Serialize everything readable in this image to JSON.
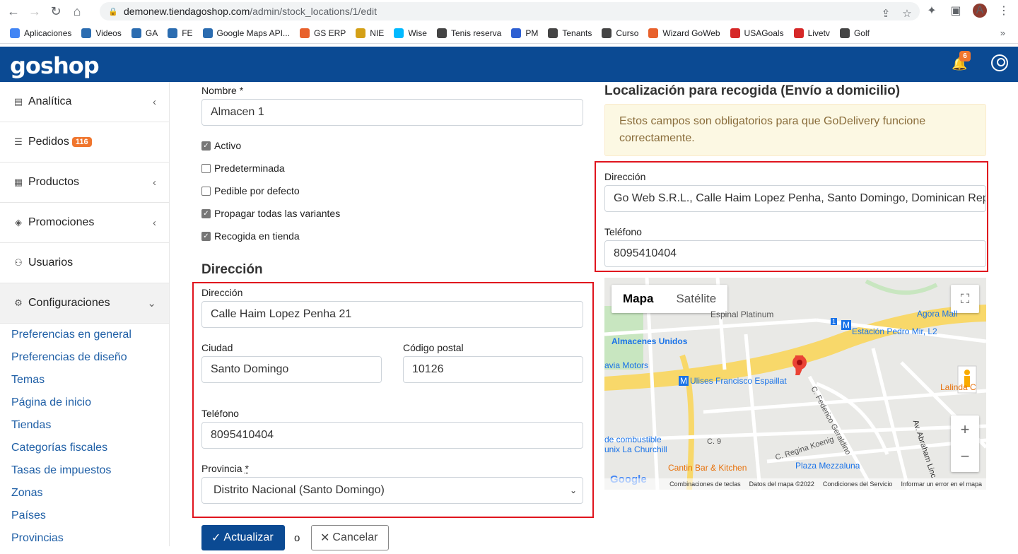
{
  "browser": {
    "url_host": "demonew.tiendagoshop.com",
    "url_path": "/admin/stock_locations/1/edit",
    "avatar_letter": "A",
    "bookmarks": [
      {
        "label": "Aplicaciones",
        "color": "#4285f4"
      },
      {
        "label": "Videos",
        "color": "#2b6cb0"
      },
      {
        "label": "GA",
        "color": "#2b6cb0"
      },
      {
        "label": "FE",
        "color": "#2b6cb0"
      },
      {
        "label": "Google Maps API...",
        "color": "#2b6cb0"
      },
      {
        "label": "GS ERP",
        "color": "#e8612c"
      },
      {
        "label": "NIE",
        "color": "#d4a017"
      },
      {
        "label": "Wise",
        "color": "#00b9ff"
      },
      {
        "label": "Tenis reserva",
        "color": "#444444"
      },
      {
        "label": "PM",
        "color": "#2d5fd2"
      },
      {
        "label": "Tenants",
        "color": "#444444"
      },
      {
        "label": "Curso",
        "color": "#444444"
      },
      {
        "label": "Wizard GoWeb",
        "color": "#e8612c"
      },
      {
        "label": "USAGoals",
        "color": "#d62828"
      },
      {
        "label": "Livetv",
        "color": "#d62828"
      },
      {
        "label": "Golf",
        "color": "#444444"
      }
    ],
    "more": "»"
  },
  "app": {
    "logo": "goshop",
    "notifications": "6"
  },
  "sidebar": {
    "items": [
      {
        "label": "Analítica",
        "icon": "📄"
      },
      {
        "label": "Pedidos",
        "icon": "☰",
        "badge": "116"
      },
      {
        "label": "Productos",
        "icon": "▦"
      },
      {
        "label": "Promociones",
        "icon": "🏷"
      },
      {
        "label": "Usuarios",
        "icon": "👥"
      },
      {
        "label": "Configuraciones",
        "icon": "⚙"
      }
    ],
    "sub_items": [
      "Preferencias en general",
      "Preferencias de diseño",
      "Temas",
      "Página de inicio",
      "Tiendas",
      "Categorías fiscales",
      "Tasas de impuestos",
      "Zonas",
      "Países",
      "Provincias"
    ]
  },
  "form": {
    "nombre_label": "Nombre",
    "required_mark": "*",
    "nombre_value": "Almacen 1",
    "checkboxes": [
      {
        "label": "Activo",
        "checked": true
      },
      {
        "label": "Predeterminada",
        "checked": false
      },
      {
        "label": "Pedible por defecto",
        "checked": false
      },
      {
        "label": "Propagar todas las variantes",
        "checked": true
      },
      {
        "label": "Recogida en tienda",
        "checked": true
      }
    ],
    "direccion_section": "Dirección",
    "direccion_label": "Dirección",
    "direccion_value": "Calle Haim Lopez Penha 21",
    "ciudad_label": "Ciudad",
    "ciudad_value": "Santo Domingo",
    "cp_label": "Código postal",
    "cp_value": "10126",
    "telefono_label": "Teléfono",
    "telefono_value": "8095410404",
    "provincia_label": "Provincia",
    "provincia_value": "Distrito Nacional (Santo Domingo)",
    "update_label": "Actualizar",
    "or_label": "o",
    "cancel_label": "Cancelar"
  },
  "pickup": {
    "title": "Localización para recogida (Envío a domicilio)",
    "alert": "Estos campos son obligatorios para que GoDelivery funcione correctamente.",
    "direccion_label": "Dirección",
    "direccion_value": "Go Web S.R.L., Calle Haim Lopez Penha, Santo Domingo, Dominican Republic",
    "telefono_label": "Teléfono",
    "telefono_value": "8095410404"
  },
  "map": {
    "tab_map": "Mapa",
    "tab_sat": "Satélite",
    "labels": {
      "espinal": "Espinal Platinum",
      "agora": "Agora Mall",
      "estacion": "Estación Pedro Mir, L2",
      "almacenes": "Almacenes Unidos",
      "motors": "avia Motors",
      "ulises": "Ulises Francisco Espaillat",
      "federico": "C. Federico Geraldino",
      "lalinda": "Lalinda C",
      "combustible": "de combustible",
      "churchill": "unix La Churchill",
      "regina": "C. Regina Koenig",
      "c9": "C. 9",
      "abraham": "Av. Abraham Linc",
      "cantin": "Cantin Bar & Kitchen",
      "mezzaluna": "Plaza Mezzaluna",
      "route": "1",
      "metro1": "M",
      "metro2": "M"
    },
    "google": "Google",
    "footer": [
      "Combinaciones de teclas",
      "Datos del mapa ©2022",
      "Condiciones del Servicio",
      "Informar un error en el mapa"
    ]
  }
}
